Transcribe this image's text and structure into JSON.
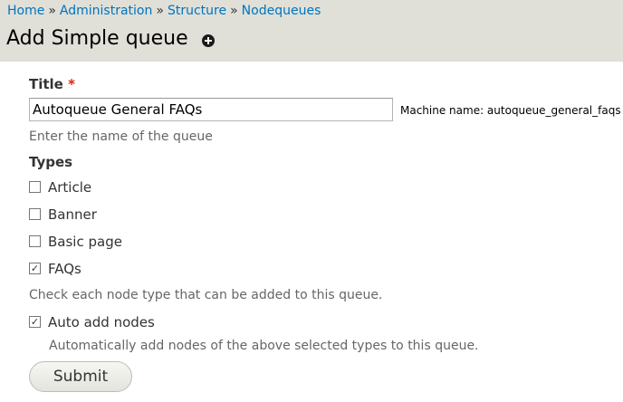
{
  "breadcrumb": {
    "items": [
      "Home",
      "Administration",
      "Structure",
      "Nodequeues"
    ],
    "separator": "»"
  },
  "page": {
    "title": "Add Simple queue",
    "add_icon": "plus-circle-icon"
  },
  "form": {
    "title_label": "Title",
    "required_marker": "*",
    "title_value": "Autoqueue General FAQs",
    "machine_name": "Machine name: autoqueue_general_faqs",
    "title_description": "Enter the name of the queue",
    "types_label": "Types",
    "types": [
      {
        "label": "Article",
        "checked": false
      },
      {
        "label": "Banner",
        "checked": false
      },
      {
        "label": "Basic page",
        "checked": false
      },
      {
        "label": "FAQs",
        "checked": true
      }
    ],
    "types_description": "Check each node type that can be added to this queue.",
    "auto_add": {
      "label": "Auto add nodes",
      "checked": true
    },
    "auto_add_description": "Automatically add nodes of the above selected types to this queue.",
    "submit_label": "Submit"
  },
  "colors": {
    "header_bg": "#e0e0d8",
    "link": "#0074bd",
    "required": "#e0200e"
  }
}
